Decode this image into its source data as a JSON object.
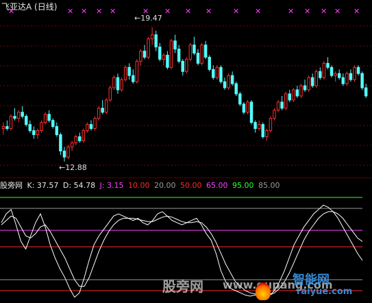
{
  "header": {
    "title": "飞亚达A (日线)"
  },
  "markers": {
    "symbol": "✕",
    "color": "#ff3cff"
  },
  "annotations": {
    "high": "19.47",
    "low": "12.88"
  },
  "indicator": {
    "name": "股旁网",
    "k_label": "K: 37.57",
    "d_label": "D: 54.78",
    "j_label": "J: 3.15",
    "levels": [
      {
        "text": "10.00",
        "color": "#ff2a2a"
      },
      {
        "text": "20.00",
        "color": "#9a9a9a"
      },
      {
        "text": "50.00",
        "color": "#ff2a2a"
      },
      {
        "text": "65.00",
        "color": "#ff40ff"
      },
      {
        "text": "95.00",
        "color": "#33ff33"
      },
      {
        "text": "85.00",
        "color": "#9a9a9a"
      }
    ]
  },
  "watermark": {
    "left": "股旁网",
    "site": "www.gupang.com",
    "brand": "智能网",
    "brand_site": "raiyue.com"
  },
  "colors": {
    "up": "#ff3030",
    "down": "#54ffff",
    "k_line": "#ffffff",
    "d_line": "#ffffff",
    "grid": "#7a0000"
  },
  "chart_data": [
    {
      "type": "candlestick",
      "title": "飞亚达A (日线)",
      "annotations": [
        {
          "label": "19.47",
          "kind": "high"
        },
        {
          "label": "12.88",
          "kind": "low"
        }
      ],
      "ylim": [
        12.4,
        20.2
      ],
      "grid": true,
      "series": [
        {
          "name": "price",
          "values": [
            [
              14.5,
              14.8,
              14.2,
              14.6
            ],
            [
              14.6,
              14.9,
              14.4,
              14.5
            ],
            [
              14.5,
              15.2,
              14.4,
              15.1
            ],
            [
              15.1,
              15.5,
              14.9,
              15.0
            ],
            [
              15.0,
              15.4,
              14.8,
              15.3
            ],
            [
              15.3,
              15.6,
              15.0,
              15.1
            ],
            [
              15.1,
              15.2,
              14.6,
              14.7
            ],
            [
              14.7,
              14.9,
              14.3,
              14.4
            ],
            [
              14.4,
              14.6,
              14.0,
              14.2
            ],
            [
              14.2,
              14.5,
              14.0,
              14.4
            ],
            [
              14.4,
              14.9,
              14.3,
              14.8
            ],
            [
              14.8,
              15.3,
              14.7,
              15.2
            ],
            [
              15.2,
              15.4,
              14.8,
              14.9
            ],
            [
              14.9,
              15.0,
              14.5,
              14.6
            ],
            [
              14.6,
              14.8,
              14.1,
              14.2
            ],
            [
              14.2,
              14.3,
              13.2,
              13.4
            ],
            [
              13.4,
              13.6,
              12.88,
              13.1
            ],
            [
              13.1,
              13.7,
              13.0,
              13.6
            ],
            [
              13.6,
              13.9,
              13.4,
              13.8
            ],
            [
              13.8,
              14.2,
              13.7,
              14.1
            ],
            [
              14.1,
              14.3,
              13.8,
              13.9
            ],
            [
              13.9,
              14.5,
              13.8,
              14.4
            ],
            [
              14.4,
              14.8,
              14.3,
              14.7
            ],
            [
              14.7,
              14.9,
              14.4,
              14.5
            ],
            [
              14.5,
              15.1,
              14.4,
              15.0
            ],
            [
              15.0,
              15.6,
              14.9,
              15.5
            ],
            [
              15.5,
              15.9,
              15.2,
              15.3
            ],
            [
              15.3,
              16.0,
              15.2,
              15.9
            ],
            [
              15.9,
              16.6,
              15.8,
              16.5
            ],
            [
              16.5,
              17.1,
              16.4,
              17.0
            ],
            [
              17.0,
              17.2,
              16.2,
              16.4
            ],
            [
              16.4,
              17.0,
              16.3,
              16.9
            ],
            [
              16.9,
              17.6,
              16.8,
              17.5
            ],
            [
              17.5,
              17.7,
              16.9,
              17.1
            ],
            [
              17.1,
              17.4,
              16.7,
              16.8
            ],
            [
              16.8,
              17.9,
              16.7,
              17.8
            ],
            [
              17.8,
              18.4,
              17.6,
              18.3
            ],
            [
              18.3,
              18.6,
              17.9,
              18.0
            ],
            [
              18.0,
              19.0,
              17.9,
              18.9
            ],
            [
              18.9,
              19.47,
              18.6,
              19.1
            ],
            [
              19.1,
              19.3,
              18.3,
              18.5
            ],
            [
              18.5,
              18.7,
              17.8,
              17.9
            ],
            [
              17.9,
              18.2,
              17.6,
              18.1
            ],
            [
              18.1,
              18.3,
              17.4,
              17.5
            ],
            [
              17.5,
              18.9,
              17.4,
              18.8
            ],
            [
              18.8,
              19.1,
              18.2,
              18.4
            ],
            [
              18.4,
              18.6,
              17.7,
              17.8
            ],
            [
              17.8,
              17.9,
              17.1,
              17.3
            ],
            [
              17.3,
              18.0,
              17.2,
              17.9
            ],
            [
              17.9,
              18.7,
              17.8,
              18.6
            ],
            [
              18.6,
              19.0,
              18.1,
              18.2
            ],
            [
              18.2,
              18.4,
              17.6,
              17.7
            ],
            [
              17.7,
              18.7,
              17.6,
              18.6
            ],
            [
              18.6,
              18.8,
              17.9,
              18.0
            ],
            [
              18.0,
              18.1,
              17.3,
              17.4
            ],
            [
              17.4,
              17.6,
              16.9,
              17.0
            ],
            [
              17.0,
              17.6,
              16.9,
              17.5
            ],
            [
              17.5,
              17.6,
              16.7,
              16.8
            ],
            [
              16.8,
              17.0,
              16.4,
              16.5
            ],
            [
              16.5,
              17.2,
              16.4,
              17.1
            ],
            [
              17.1,
              17.3,
              16.6,
              16.7
            ],
            [
              16.7,
              16.8,
              16.1,
              16.2
            ],
            [
              16.2,
              16.3,
              15.6,
              15.7
            ],
            [
              15.7,
              15.8,
              15.2,
              15.3
            ],
            [
              15.3,
              15.9,
              15.2,
              15.8
            ],
            [
              15.8,
              15.9,
              14.7,
              14.8
            ],
            [
              14.8,
              14.9,
              14.3,
              14.5
            ],
            [
              14.5,
              14.9,
              14.4,
              14.7
            ],
            [
              14.7,
              14.8,
              14.0,
              14.1
            ],
            [
              14.1,
              14.5,
              13.9,
              14.4
            ],
            [
              14.4,
              15.1,
              14.3,
              15.0
            ],
            [
              15.0,
              15.5,
              14.9,
              15.4
            ],
            [
              15.4,
              15.9,
              15.3,
              15.8
            ],
            [
              15.8,
              16.1,
              15.4,
              15.5
            ],
            [
              15.5,
              16.3,
              15.4,
              16.2
            ],
            [
              16.2,
              16.4,
              15.8,
              15.9
            ],
            [
              15.9,
              16.5,
              15.8,
              16.4
            ],
            [
              16.4,
              16.6,
              16.0,
              16.1
            ],
            [
              16.1,
              16.7,
              16.0,
              16.6
            ],
            [
              16.6,
              16.9,
              16.3,
              16.4
            ],
            [
              16.4,
              17.1,
              16.3,
              17.0
            ],
            [
              17.0,
              17.2,
              16.5,
              16.6
            ],
            [
              16.6,
              17.4,
              16.5,
              17.3
            ],
            [
              17.3,
              17.5,
              16.9,
              17.0
            ],
            [
              17.0,
              17.8,
              16.9,
              17.7
            ],
            [
              17.7,
              18.0,
              17.4,
              17.5
            ],
            [
              17.5,
              17.6,
              17.0,
              17.1
            ],
            [
              17.1,
              17.3,
              16.8,
              17.2
            ],
            [
              17.2,
              17.4,
              16.9,
              17.0
            ],
            [
              17.0,
              17.2,
              16.6,
              16.7
            ],
            [
              16.7,
              17.3,
              16.6,
              17.2
            ],
            [
              17.2,
              17.4,
              16.8,
              16.9
            ],
            [
              16.9,
              17.6,
              16.8,
              17.5
            ],
            [
              17.5,
              17.6,
              17.1,
              17.2
            ],
            [
              17.2,
              17.3,
              16.4,
              16.5
            ],
            [
              16.5,
              16.7,
              16.0,
              16.1
            ]
          ]
        }
      ]
    },
    {
      "type": "line",
      "title": "股旁网",
      "ylim": [
        0,
        100
      ],
      "reference_lines": [
        10,
        20,
        50,
        65,
        85,
        95
      ],
      "series": [
        {
          "name": "K",
          "values": [
            72,
            80,
            84,
            70,
            55,
            48,
            60,
            72,
            80,
            68,
            52,
            40,
            30,
            22,
            12,
            4,
            8,
            22,
            38,
            52,
            60,
            66,
            72,
            78,
            80,
            78,
            76,
            74,
            76,
            72,
            70,
            74,
            80,
            82,
            78,
            74,
            72,
            70,
            72,
            74,
            76,
            70,
            62,
            56,
            44,
            28,
            18,
            12,
            10,
            8,
            6,
            5,
            6,
            5,
            4,
            6,
            10,
            18,
            28,
            40,
            52,
            60,
            68,
            74,
            80,
            84,
            88,
            86,
            82,
            76,
            68,
            60,
            52,
            44,
            37.57
          ]
        },
        {
          "name": "D",
          "values": [
            70,
            74,
            78,
            76,
            68,
            60,
            58,
            62,
            68,
            70,
            64,
            56,
            48,
            40,
            30,
            20,
            14,
            14,
            22,
            34,
            46,
            56,
            64,
            70,
            74,
            76,
            76,
            76,
            75,
            74,
            73,
            73,
            75,
            77,
            78,
            77,
            75,
            73,
            72,
            72,
            73,
            72,
            68,
            62,
            54,
            44,
            34,
            26,
            18,
            14,
            10,
            8,
            7,
            6,
            6,
            6,
            8,
            12,
            18,
            26,
            36,
            46,
            56,
            64,
            70,
            76,
            80,
            82,
            82,
            80,
            76,
            70,
            64,
            58,
            54.78
          ]
        }
      ]
    }
  ]
}
